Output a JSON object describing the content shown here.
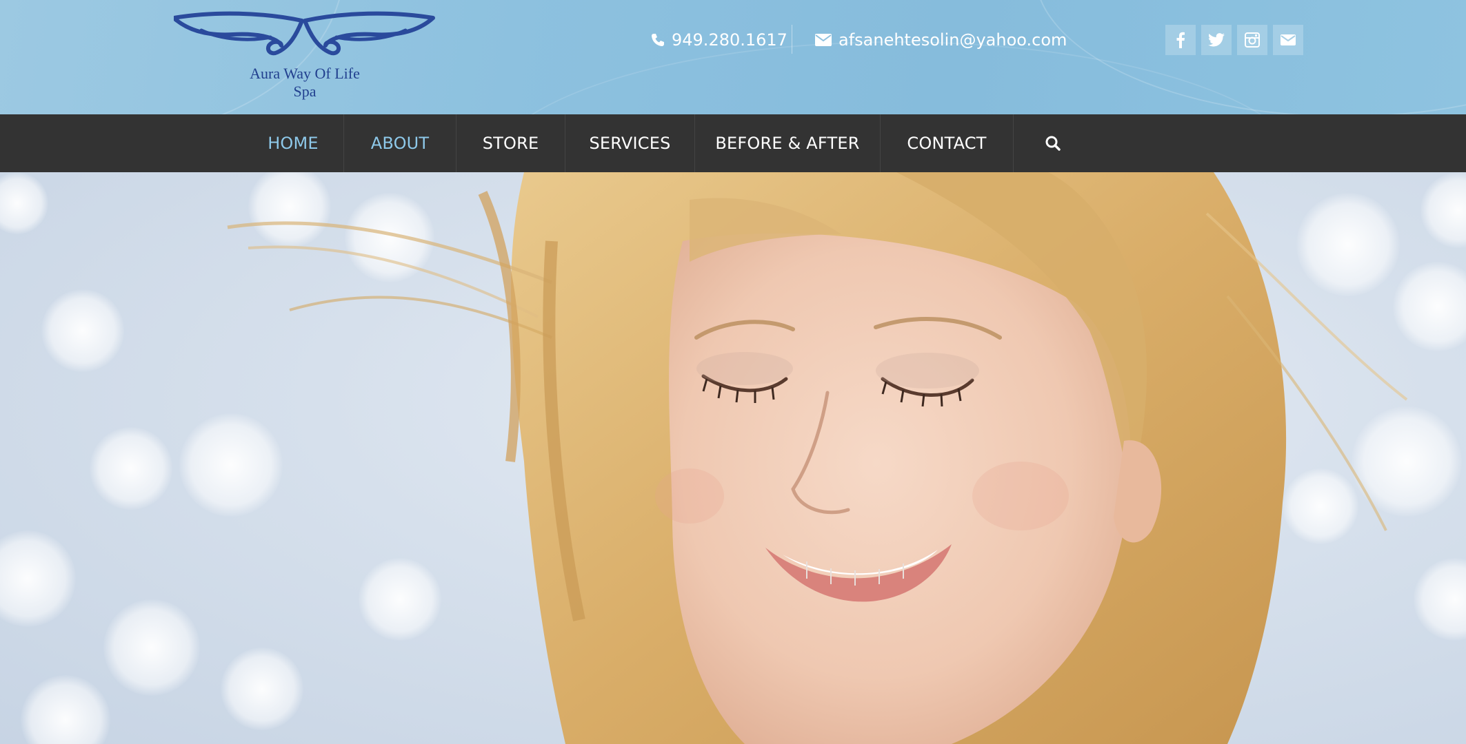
{
  "logo": {
    "line1": "Aura Way Of Life",
    "line2": "Spa",
    "color": "#22408f"
  },
  "contact": {
    "phone": "949.280.1617",
    "email": "afsanehtesolin@yahoo.com",
    "phone_icon": "phone-icon",
    "email_icon": "envelope-icon"
  },
  "social": [
    {
      "name": "facebook-icon"
    },
    {
      "name": "twitter-icon"
    },
    {
      "name": "instagram-icon"
    },
    {
      "name": "envelope-icon"
    }
  ],
  "nav": {
    "items": [
      {
        "label": "HOME",
        "active": true
      },
      {
        "label": "ABOUT",
        "active": true
      },
      {
        "label": "STORE",
        "active": false
      },
      {
        "label": "SERVICES",
        "active": false
      },
      {
        "label": "BEFORE & AFTER",
        "active": false
      },
      {
        "label": "CONTACT",
        "active": false
      }
    ],
    "search_icon": "search-icon"
  },
  "colors": {
    "header_bg": "#8dc1df",
    "nav_bg": "#333333",
    "nav_active": "#8ec9ea",
    "nav_text": "#ffffff"
  },
  "hero": {
    "image": "smiling-woman-blonde-hair-bokeh-background"
  }
}
